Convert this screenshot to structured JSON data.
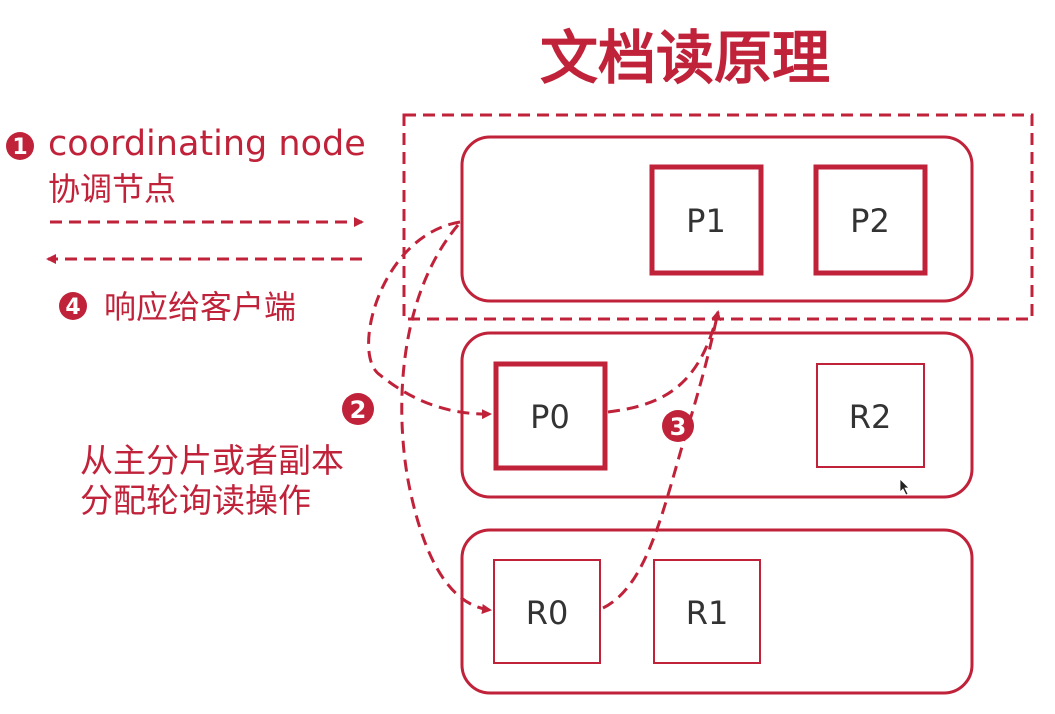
{
  "title": "文档读原理",
  "colors": {
    "accent": "#c0223a",
    "box_stroke": "#c0223a"
  },
  "steps": {
    "step1": {
      "number": "1",
      "label": "coordinating node",
      "sublabel": "协调节点"
    },
    "step2": {
      "number": "2",
      "label_line1": "从主分片或者副本",
      "label_line2": "分配轮询读操作"
    },
    "step3": {
      "number": "3"
    },
    "step4": {
      "number": "4",
      "label": "响应给客户端"
    }
  },
  "nodes": [
    {
      "shards": [
        {
          "label": "P1",
          "kind": "primary"
        },
        {
          "label": "P2",
          "kind": "primary"
        }
      ]
    },
    {
      "shards": [
        {
          "label": "P0",
          "kind": "primary"
        },
        {
          "label": "R2",
          "kind": "replica"
        }
      ]
    },
    {
      "shards": [
        {
          "label": "R0",
          "kind": "replica"
        },
        {
          "label": "R1",
          "kind": "replica"
        }
      ]
    }
  ]
}
